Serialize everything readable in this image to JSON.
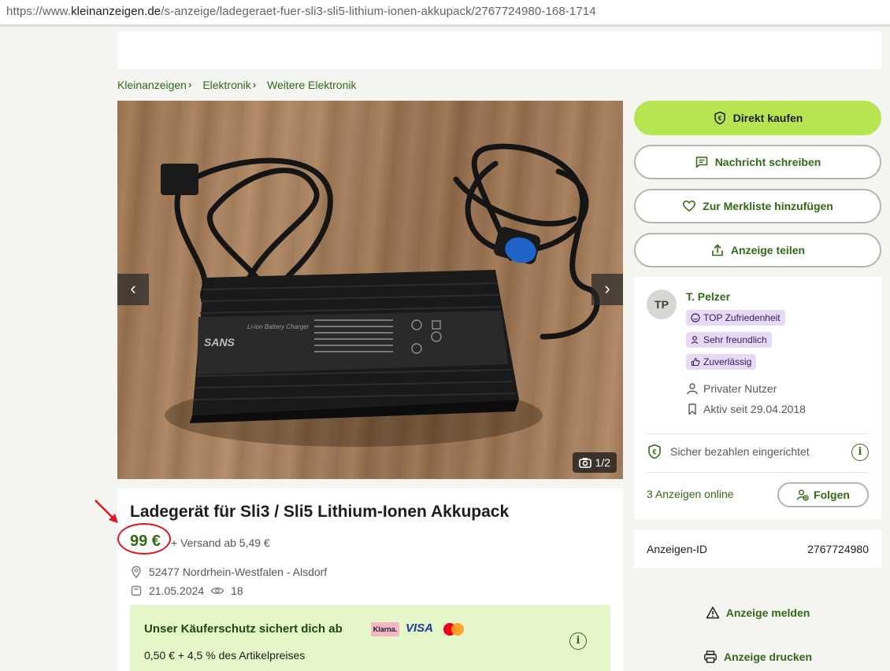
{
  "browser": {
    "url_prefix": "https://www.",
    "url_domain": "kleinanzeigen.de",
    "url_path": "/s-anzeige/ladegeraet-fuer-sli3-sli5-lithium-ionen-akkupack/2767724980-168-1714"
  },
  "breadcrumb": [
    "Kleinanzeigen",
    "Elektronik",
    "Weitere Elektronik"
  ],
  "gallery": {
    "counter": "1/2",
    "product_brand": "SANS",
    "product_label": "Li-ion Battery Charger"
  },
  "actions": {
    "buy": "Direkt kaufen",
    "message": "Nachricht schreiben",
    "watchlist": "Zur Merkliste hinzufügen",
    "share": "Anzeige teilen"
  },
  "seller": {
    "initials": "TP",
    "name": "T. Pelzer",
    "badges": [
      "TOP Zufriedenheit",
      "Sehr freundlich",
      "Zuverlässig"
    ],
    "type": "Privater Nutzer",
    "active_since": "Aktiv seit 29.04.2018",
    "secure_payment": "Sicher bezahlen eingerichtet",
    "ads_online": "3 Anzeigen online",
    "follow": "Folgen"
  },
  "ad": {
    "id_label": "Anzeigen-ID",
    "id": "2767724980",
    "report": "Anzeige melden",
    "print": "Anzeige drucken",
    "title": "Ladegerät für Sli3 / Sli5 Lithium-Ionen Akkupack",
    "price": "99 €",
    "shipping": "+ Versand ab 5,49 €",
    "location": "52477 Nordrhein-Westfalen - Alsdorf",
    "date": "21.05.2024",
    "views": "18"
  },
  "buyer_protection": {
    "heading": "Unser Käuferschutz sichert dich ab",
    "fee": "0,50 € + 4,5 % des Artikelpreises",
    "klarna": "Klarna.",
    "visa": "VISA"
  },
  "colors": {
    "brand_green": "#326916",
    "buy_green": "#b7e551",
    "annotation_red": "#e0141a"
  }
}
